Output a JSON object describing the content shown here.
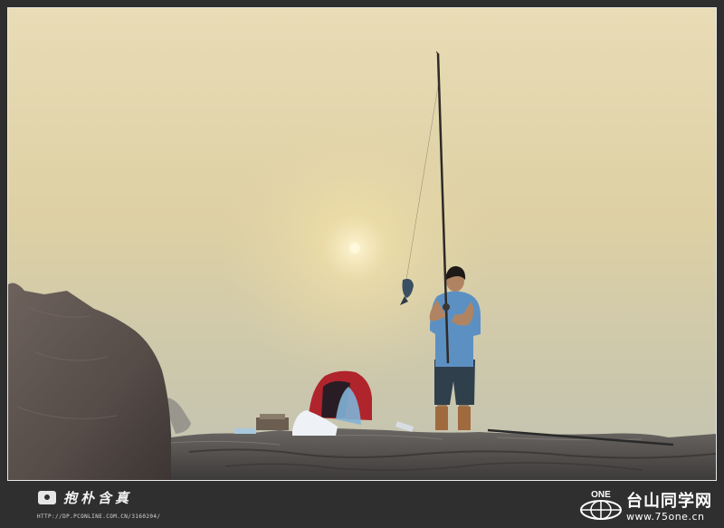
{
  "photo": {
    "scene": "fisherman-on-rocks-at-foggy-sunrise",
    "colors": {
      "sky_top": "#e9dcb6",
      "sky_mid": "#d8c899",
      "sky_low": "#c8c4a8",
      "sun": "#fff4c8",
      "rock": "#5e5450",
      "shirt": "#5c8fc0",
      "shorts": "#2e3e4a"
    }
  },
  "footer": {
    "author_signature": "抱朴含真",
    "author_url": "HTTP://DP.PCONLINE.COM.CN/3160204/",
    "site_logo_text": "ONE",
    "site_name": "台山同学网",
    "site_url": "www.75one.cn"
  }
}
